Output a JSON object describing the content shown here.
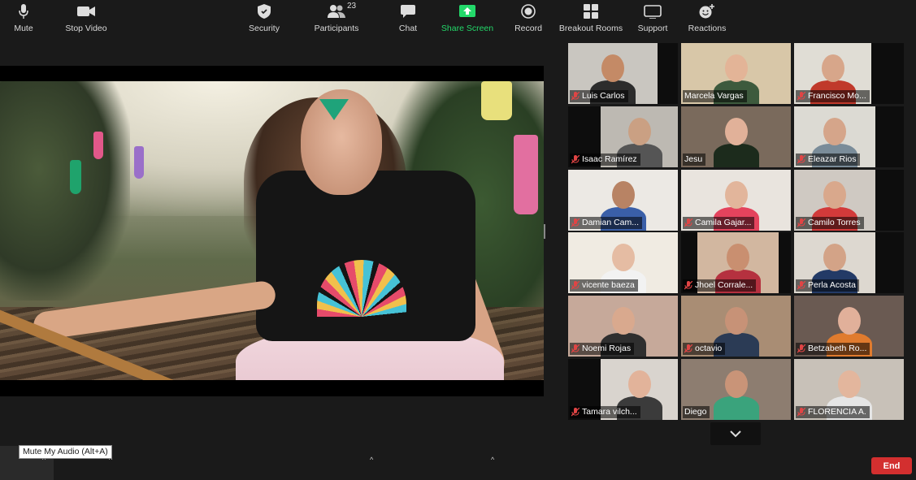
{
  "gallery": {
    "tiles": [
      {
        "name": "Luis Carlos",
        "muted": true,
        "active": false,
        "bg": "#c9c6c0",
        "skin": "#c48a66",
        "shirt": "#2c2c2c"
      },
      {
        "name": "Marcela Vargas",
        "muted": false,
        "active": false,
        "bg": "#d8c7a8",
        "skin": "#e3b497",
        "shirt": "#3d5a3d"
      },
      {
        "name": "Francisco Mo...",
        "muted": true,
        "active": false,
        "bg": "#e0ddd5",
        "skin": "#d7a68a",
        "shirt": "#c0392b"
      },
      {
        "name": "Isaac Ramírez",
        "muted": true,
        "active": false,
        "bg": "#bdb9b2",
        "skin": "#caa083",
        "shirt": "#555"
      },
      {
        "name": "Jesu",
        "muted": false,
        "active": true,
        "bg": "#7a6a5c",
        "skin": "#e1b199",
        "shirt": "#1c2b1c"
      },
      {
        "name": "Eleazar Rios",
        "muted": true,
        "active": false,
        "bg": "#dcdad3",
        "skin": "#d5a58a",
        "shirt": "#7a8c99"
      },
      {
        "name": "Damian Cam...",
        "muted": true,
        "active": false,
        "bg": "#ece9e4",
        "skin": "#b88364",
        "shirt": "#3a5fa8"
      },
      {
        "name": "Camila Gajar...",
        "muted": true,
        "active": false,
        "bg": "#e9e4de",
        "skin": "#e2b59b",
        "shirt": "#e4435d"
      },
      {
        "name": "Camilo Torres",
        "muted": true,
        "active": false,
        "bg": "#cfc9c2",
        "skin": "#d9a88c",
        "shirt": "#d23a3a"
      },
      {
        "name": "vicente baeza",
        "muted": true,
        "active": false,
        "bg": "#f0ebe2",
        "skin": "#e5bca3",
        "shirt": "#f2f2f2"
      },
      {
        "name": "Jhoel Corrale...",
        "muted": true,
        "active": false,
        "bg": "#d2b7a0",
        "skin": "#c98f70",
        "shirt": "#b5313f"
      },
      {
        "name": "Perla Acosta",
        "muted": true,
        "active": false,
        "bg": "#ddd8d0",
        "skin": "#d3a387",
        "shirt": "#233a66"
      },
      {
        "name": "Noemi Rojas",
        "muted": true,
        "active": false,
        "bg": "#c6a99a",
        "skin": "#d9a98e",
        "shirt": "#2f2f2f"
      },
      {
        "name": "octavio",
        "muted": true,
        "active": false,
        "bg": "#a98d74",
        "skin": "#c79277",
        "shirt": "#2b3b55"
      },
      {
        "name": "Betzabeth Ro...",
        "muted": true,
        "active": false,
        "bg": "#6a5a52",
        "skin": "#e1b09a",
        "shirt": "#e07b2e"
      },
      {
        "name": "Tamara vilch...",
        "muted": true,
        "active": false,
        "bg": "#d9d4ce",
        "skin": "#e2b39a",
        "shirt": "#3b3b3b"
      },
      {
        "name": "Diego",
        "muted": false,
        "active": false,
        "bg": "#8d7d70",
        "skin": "#c99478",
        "shirt": "#3aa37c"
      },
      {
        "name": "FLORENCIA A.",
        "muted": true,
        "active": false,
        "bg": "#c8c1b8",
        "skin": "#e3b69d",
        "shirt": "#e5e5e5"
      }
    ]
  },
  "toolbar": {
    "mute_label": "Mute",
    "stop_video_label": "Stop Video",
    "security_label": "Security",
    "participants_label": "Participants",
    "participants_count": "23",
    "chat_label": "Chat",
    "share_screen_label": "Share Screen",
    "record_label": "Record",
    "breakout_label": "Breakout Rooms",
    "support_label": "Support",
    "reactions_label": "Reactions",
    "end_label": "End",
    "mute_tooltip": "Mute My Audio (Alt+A)"
  },
  "colors": {
    "active_speaker": "#c5e34a",
    "share_green": "#23d96a",
    "end_red": "#d32f2f",
    "muted_red": "#e04545"
  }
}
